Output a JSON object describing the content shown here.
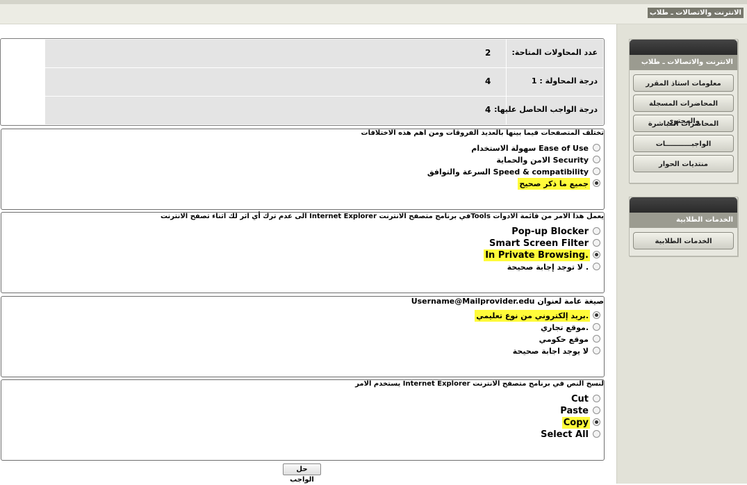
{
  "header": {
    "title": "الانترنت والاتصالات ـ طلاب"
  },
  "sidebar": {
    "panel1": {
      "title": "الانترنت والاتصالات ـ طلاب",
      "items": [
        "معلومات استاذ المقرر",
        "المحاضرات المسجلة والمحتوى",
        "المحاضرات المباشرة",
        "الواجبـــــــــــات",
        "منتديات الحوار"
      ]
    },
    "panel2": {
      "title": "الخدمات الطلابية",
      "items": [
        "الخدمات الطلابية"
      ]
    }
  },
  "info": {
    "rows": [
      {
        "label": "عدد المحاولات المتاحة:",
        "value": "2"
      },
      {
        "label": "درجة المحاولة : 1",
        "value": "4"
      },
      {
        "label": "درجة الواجب الحاصل عليها:",
        "value": "4"
      }
    ]
  },
  "questions": [
    {
      "text": "تختلف المتصفحات فيما بينها بالعديد الفروقات ومن اهم هذه الاختلافات",
      "options": [
        {
          "label": "سهولة الاستخدام Ease of Use",
          "selected": false,
          "highlighted": false
        },
        {
          "label": "الامن والحماية Security",
          "selected": false,
          "highlighted": false
        },
        {
          "label": "السرعة والتوافق Speed & compatibility",
          "selected": false,
          "highlighted": false
        },
        {
          "label": "جميع ما ذكر صحيح",
          "selected": true,
          "highlighted": true
        }
      ]
    },
    {
      "text": "يعمل هذا الامر من قائمة الادوات Toolsفي برنامج متصفح الانترنت Internet Explorer الى عدم ترك أي اثر لك اثناء تصفح الانترنت",
      "options": [
        {
          "label": "Pop-up Blocker",
          "selected": false,
          "highlighted": false
        },
        {
          "label": "Smart Screen Filter",
          "selected": false,
          "highlighted": false
        },
        {
          "label": "In Private Browsing.",
          "selected": true,
          "highlighted": true
        },
        {
          "label": "لا توجد إجابة صحيحة .",
          "selected": false,
          "highlighted": false
        }
      ]
    },
    {
      "text": "صيغة عامة لعنوان Username@Mailprovider.edu",
      "options": [
        {
          "label": "بريد إلكتروني من نوع تعليمي.",
          "selected": true,
          "highlighted": true
        },
        {
          "label": "موقع تجاري.",
          "selected": false,
          "highlighted": false
        },
        {
          "label": "موقع حكومي",
          "selected": false,
          "highlighted": false
        },
        {
          "label": "لا يوجد اجابة صحيحة",
          "selected": false,
          "highlighted": false
        }
      ]
    },
    {
      "text": "لنسخ النص في برنامج متصفح الانترنت Internet Explorer يستخدم الامر",
      "options": [
        {
          "label": "Cut",
          "selected": false,
          "highlighted": false
        },
        {
          "label": "Paste",
          "selected": false,
          "highlighted": false
        },
        {
          "label": "Copy",
          "selected": true,
          "highlighted": true
        },
        {
          "label": "Select All",
          "selected": false,
          "highlighted": false
        }
      ]
    }
  ],
  "submit_label": "حل الواجب",
  "colors": {
    "highlight": "#fffb3a",
    "sidebar_header": "#9b9b90",
    "info_row": "#e4e4e4"
  }
}
